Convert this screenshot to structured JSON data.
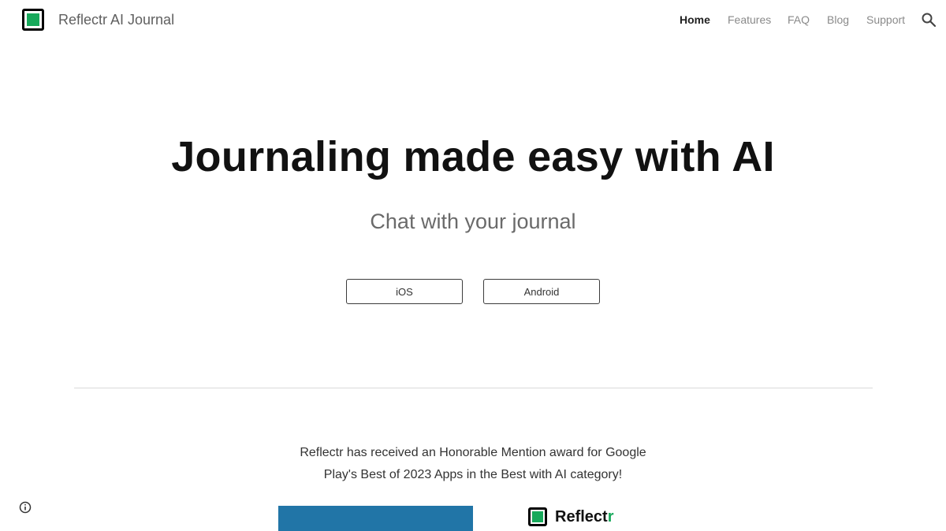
{
  "header": {
    "site_title": "Reflectr AI Journal",
    "nav": [
      {
        "label": "Home",
        "active": true
      },
      {
        "label": "Features",
        "active": false
      },
      {
        "label": "FAQ",
        "active": false
      },
      {
        "label": "Blog",
        "active": false
      },
      {
        "label": "Support",
        "active": false
      }
    ],
    "search_icon": "search-icon"
  },
  "hero": {
    "title": "Journaling made easy with AI",
    "subtitle": "Chat with your journal",
    "buttons": {
      "ios": "iOS",
      "android": "Android"
    }
  },
  "award": {
    "line1": "Reflectr has received an Honorable Mention award for Google",
    "line2": "Play's Best of 2023 Apps in the Best with AI category!"
  },
  "brand": {
    "name_main": "Reflect",
    "name_accent": "r"
  },
  "colors": {
    "brand_green": "#17a95b",
    "image_blue": "#2175a7",
    "nav_inactive": "#8a8a8a",
    "nav_active": "#212121"
  }
}
